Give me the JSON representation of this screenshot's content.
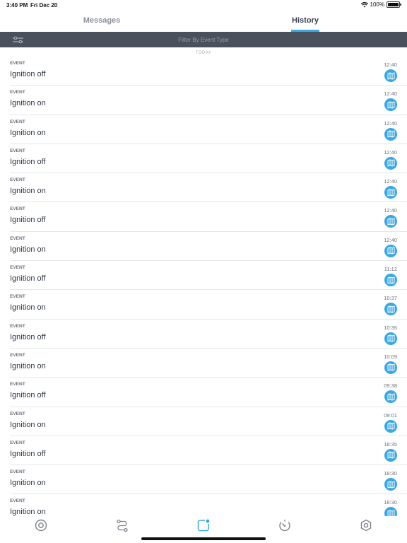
{
  "status_bar": {
    "time": "3:40 PM",
    "date": "Fri Dec 20",
    "battery": "100%"
  },
  "tabs": [
    {
      "label": "Messages",
      "active": false
    },
    {
      "label": "History",
      "active": true
    }
  ],
  "filter": {
    "label": "Filter By Event Type",
    "icon": "filter-sliders-icon"
  },
  "day_header": "TODAY",
  "events": [
    {
      "type": "EVENT",
      "title": "Ignition off",
      "time": "12:40"
    },
    {
      "type": "EVENT",
      "title": "Ignition on",
      "time": "12:40"
    },
    {
      "type": "EVENT",
      "title": "Ignition on",
      "time": "12:40"
    },
    {
      "type": "EVENT",
      "title": "Ignition off",
      "time": "12:40"
    },
    {
      "type": "EVENT",
      "title": "Ignition on",
      "time": "12:40"
    },
    {
      "type": "EVENT",
      "title": "Ignition off",
      "time": "12:40"
    },
    {
      "type": "EVENT",
      "title": "Ignition on",
      "time": "12:40"
    },
    {
      "type": "EVENT",
      "title": "Ignition off",
      "time": "11:12"
    },
    {
      "type": "EVENT",
      "title": "Ignition on",
      "time": "10:37"
    },
    {
      "type": "EVENT",
      "title": "Ignition off",
      "time": "10:35"
    },
    {
      "type": "EVENT",
      "title": "Ignition on",
      "time": "10:09"
    },
    {
      "type": "EVENT",
      "title": "Ignition off",
      "time": "09:38"
    },
    {
      "type": "EVENT",
      "title": "Ignition on",
      "time": "09:01"
    },
    {
      "type": "EVENT",
      "title": "Ignition off",
      "time": "18:35"
    },
    {
      "type": "EVENT",
      "title": "Ignition on",
      "time": "18:30"
    },
    {
      "type": "EVENT",
      "title": "Ignition on",
      "time": "18:30"
    }
  ],
  "bottom_nav": [
    {
      "name": "nav-dashboard",
      "icon": "target-circle-icon",
      "active": false
    },
    {
      "name": "nav-trips",
      "icon": "route-icon",
      "active": false
    },
    {
      "name": "nav-messages",
      "icon": "notification-square-icon",
      "active": true
    },
    {
      "name": "nav-speed",
      "icon": "speedometer-icon",
      "active": false
    },
    {
      "name": "nav-settings",
      "icon": "hexagon-settings-icon",
      "active": false
    }
  ],
  "colors": {
    "accent": "#3ba7e3",
    "filter_bar": "#4a505c",
    "nav_icon": "#7b828c"
  }
}
